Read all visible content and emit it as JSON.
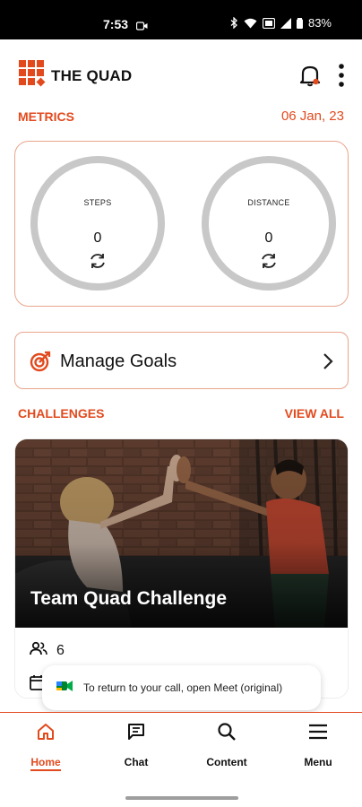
{
  "status_bar": {
    "time": "7:53",
    "battery": "83%"
  },
  "header": {
    "app_name": "THE QUAD",
    "icons": [
      "logo-icon",
      "bell-icon",
      "kebab-menu-icon"
    ]
  },
  "metrics": {
    "title": "METRICS",
    "date": "06 Jan, 23",
    "steps": {
      "label": "STEPS",
      "value": "0"
    },
    "distance": {
      "label": "DISTANCE",
      "value": "0"
    }
  },
  "goals": {
    "label": "Manage Goals"
  },
  "challenges": {
    "title": "CHALLENGES",
    "view_all": "VIEW ALL",
    "card": {
      "title": "Team Quad Challenge",
      "participants": "6"
    }
  },
  "toast": {
    "text": "To return to your call, open Meet (original)"
  },
  "bottom_nav": {
    "items": [
      {
        "label": "Home",
        "icon": "home-icon",
        "active": true
      },
      {
        "label": "Chat",
        "icon": "chat-icon",
        "active": false
      },
      {
        "label": "Content",
        "icon": "search-icon",
        "active": false
      },
      {
        "label": "Menu",
        "icon": "hamburger-icon",
        "active": false
      }
    ]
  },
  "colors": {
    "accent": "#e24a1e",
    "card_border": "#e8a58d",
    "ring": "#c8c8c8"
  }
}
